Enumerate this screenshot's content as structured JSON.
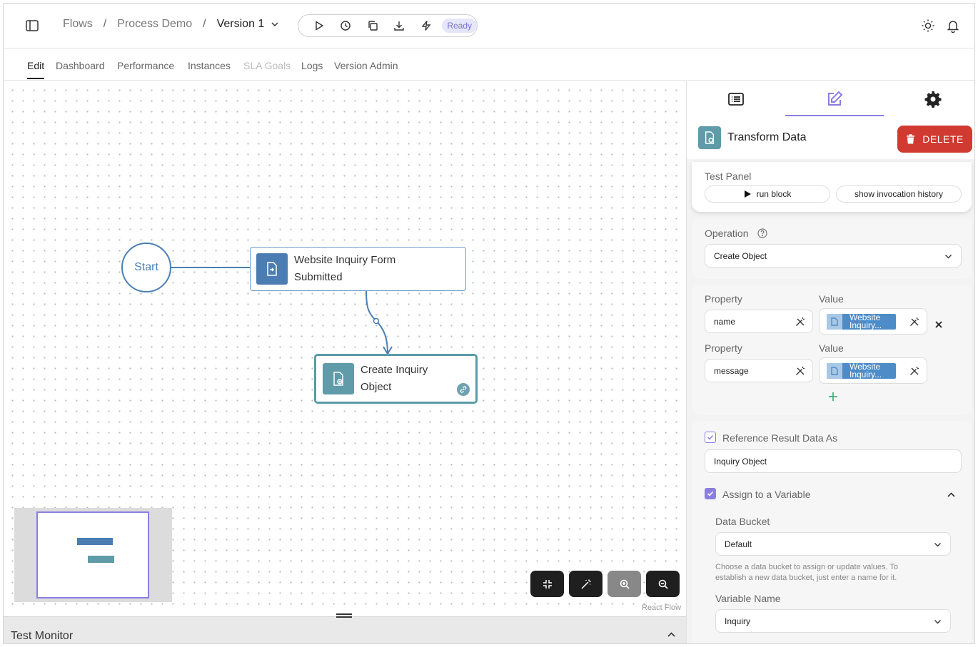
{
  "header": {
    "breadcrumb": [
      "Flows",
      "Process Demo",
      "Version 1"
    ],
    "status_badge": "Ready"
  },
  "tabs": [
    {
      "label": "Edit",
      "state": "active"
    },
    {
      "label": "Dashboard",
      "state": "normal"
    },
    {
      "label": "Performance",
      "state": "normal"
    },
    {
      "label": "Instances",
      "state": "normal"
    },
    {
      "label": "SLA Goals",
      "state": "disabled"
    },
    {
      "label": "Logs",
      "state": "normal"
    },
    {
      "label": "Version Admin",
      "state": "normal"
    }
  ],
  "canvas": {
    "start_label": "Start",
    "nodes": [
      {
        "line1": "Website Inquiry Form",
        "line2": "Submitted"
      },
      {
        "line1": "Create Inquiry",
        "line2": "Object"
      }
    ],
    "attribution": "React Flow"
  },
  "monitor": {
    "label": "Test Monitor"
  },
  "panel": {
    "block_title": "Transform Data",
    "delete_label": "DELETE",
    "test_panel": {
      "title": "Test Panel",
      "run_label": "run block",
      "history_label": "show invocation history"
    },
    "operation": {
      "label": "Operation",
      "value": "Create Object"
    },
    "properties": [
      {
        "property_label": "Property",
        "value_label": "Value",
        "name": "name",
        "chip_line1": "Website",
        "chip_line2": "Inquiry..."
      },
      {
        "property_label": "Property",
        "value_label": "Value",
        "name": "message",
        "chip_line1": "Website",
        "chip_line2": "Inquiry..."
      }
    ],
    "reference": {
      "label": "Reference Result Data As",
      "value": "Inquiry Object"
    },
    "assign": {
      "label": "Assign to a Variable",
      "bucket_label": "Data Bucket",
      "bucket_value": "Default",
      "help_line1": "Choose a data bucket to assign or update values. To",
      "help_line2": "establish a new data bucket, just enter a name for it.",
      "variable_label": "Variable Name",
      "variable_value": "Inquiry"
    }
  },
  "colors": {
    "accent": "#8a7fe0",
    "danger": "#d13a31",
    "node_blue": "#4b7db2",
    "node_teal": "#5f9ba8"
  }
}
